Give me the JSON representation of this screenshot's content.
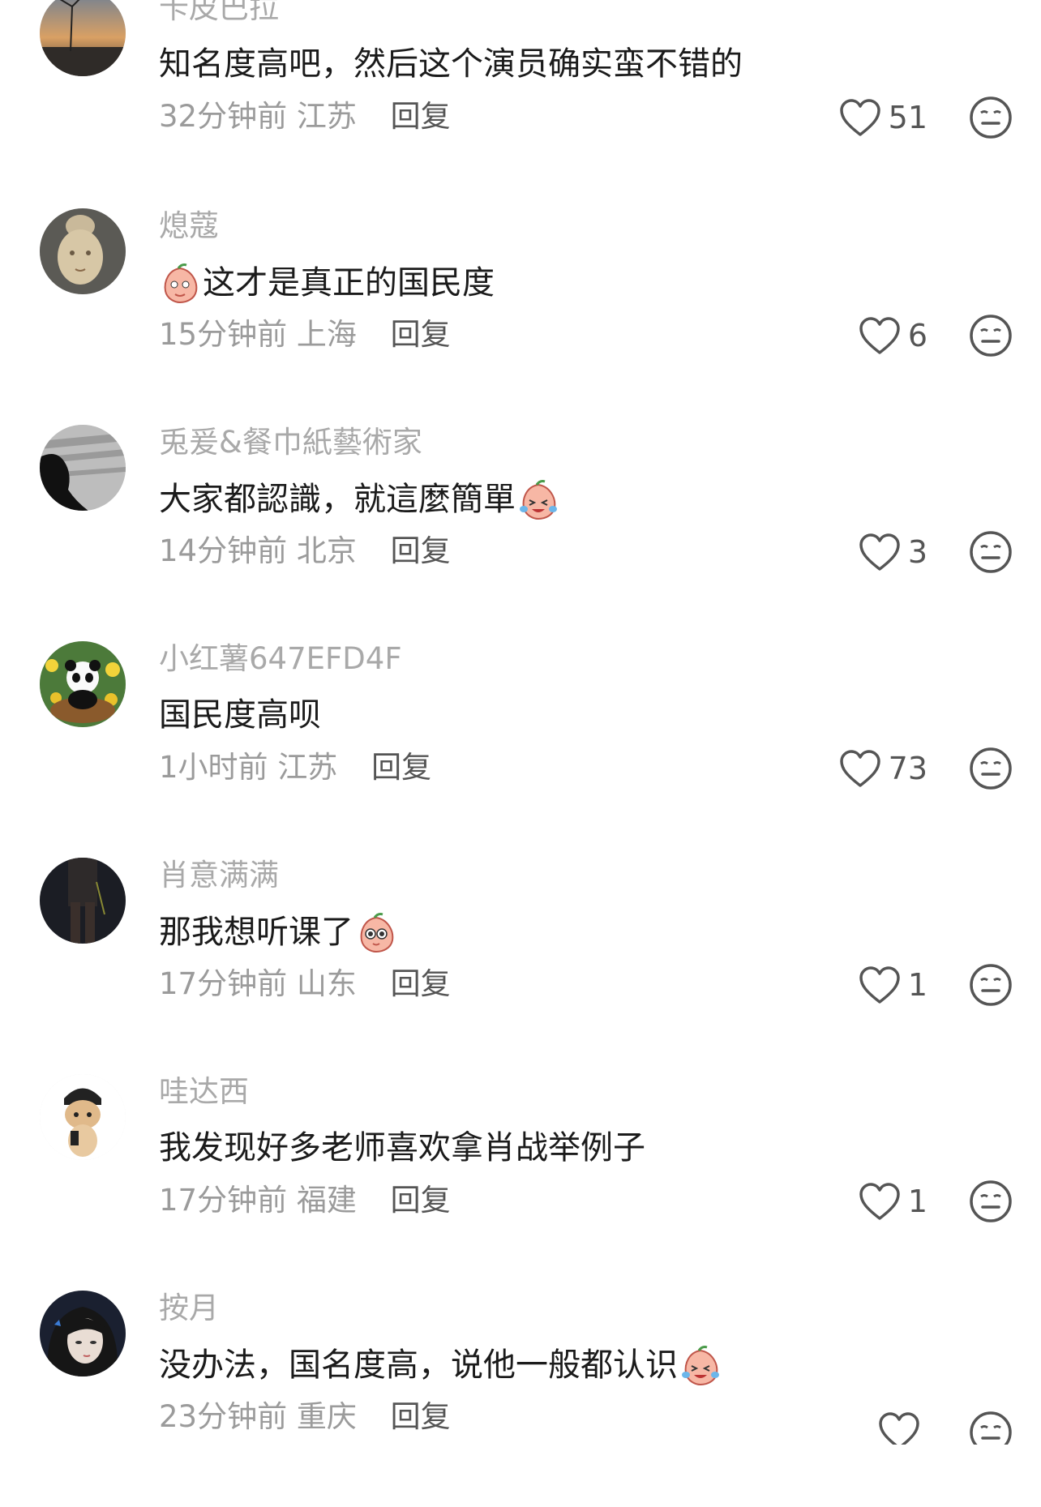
{
  "comments": [
    {
      "username": "卡皮巴拉",
      "text": "知名度高吧，然后这个演员确实蛮不错的",
      "time": "32分钟前",
      "location": "江苏",
      "reply": "回复",
      "likes": "51",
      "avatar": "windmill-sunset-avatar",
      "emoji_before": "",
      "emoji_after": ""
    },
    {
      "username": "熄蔻",
      "text": "这才是真正的国民度",
      "time": "15分钟前",
      "location": "上海",
      "reply": "回复",
      "likes": "6",
      "avatar": "statue-head-avatar",
      "emoji_before": "shy-peach-emoji",
      "emoji_after": ""
    },
    {
      "username": "兎爰&餐巾紙藝術家",
      "text": "大家都認識，就這麼簡單",
      "time": "14分钟前",
      "location": "北京",
      "reply": "回复",
      "likes": "3",
      "avatar": "dark-silhouette-avatar",
      "emoji_before": "",
      "emoji_after": "crying-laugh-peach-emoji"
    },
    {
      "username": "小红薯647EFD4F",
      "text": "国民度高呗",
      "time": "1小时前",
      "location": "江苏",
      "reply": "回复",
      "likes": "73",
      "avatar": "panda-flowers-avatar",
      "emoji_before": "",
      "emoji_after": ""
    },
    {
      "username": "肖意满满",
      "text": "那我想听课了",
      "time": "17分钟前",
      "location": "山东",
      "reply": "回复",
      "likes": "1",
      "avatar": "dark-figure-avatar",
      "emoji_before": "",
      "emoji_after": "curious-peach-emoji"
    },
    {
      "username": "哇达西",
      "text": "我发现好多老师喜欢拿肖战举例子",
      "time": "17分钟前",
      "location": "福建",
      "reply": "回复",
      "likes": "1",
      "avatar": "cat-beanie-avatar",
      "emoji_before": "",
      "emoji_after": ""
    },
    {
      "username": "按月",
      "text": "没办法，国名度高，说他一般都认识",
      "time": "23分钟前",
      "location": "重庆",
      "reply": "回复",
      "likes": "",
      "avatar": "anime-girl-avatar",
      "emoji_before": "",
      "emoji_after": "crying-laugh-peach-emoji"
    }
  ],
  "icons": {
    "like": "heart-outline-icon",
    "dislike": "neutral-face-icon"
  },
  "colors": {
    "username": "#a9a9a9",
    "text": "#1b1b1b",
    "meta": "#9b9b9b",
    "reply": "#555555"
  }
}
